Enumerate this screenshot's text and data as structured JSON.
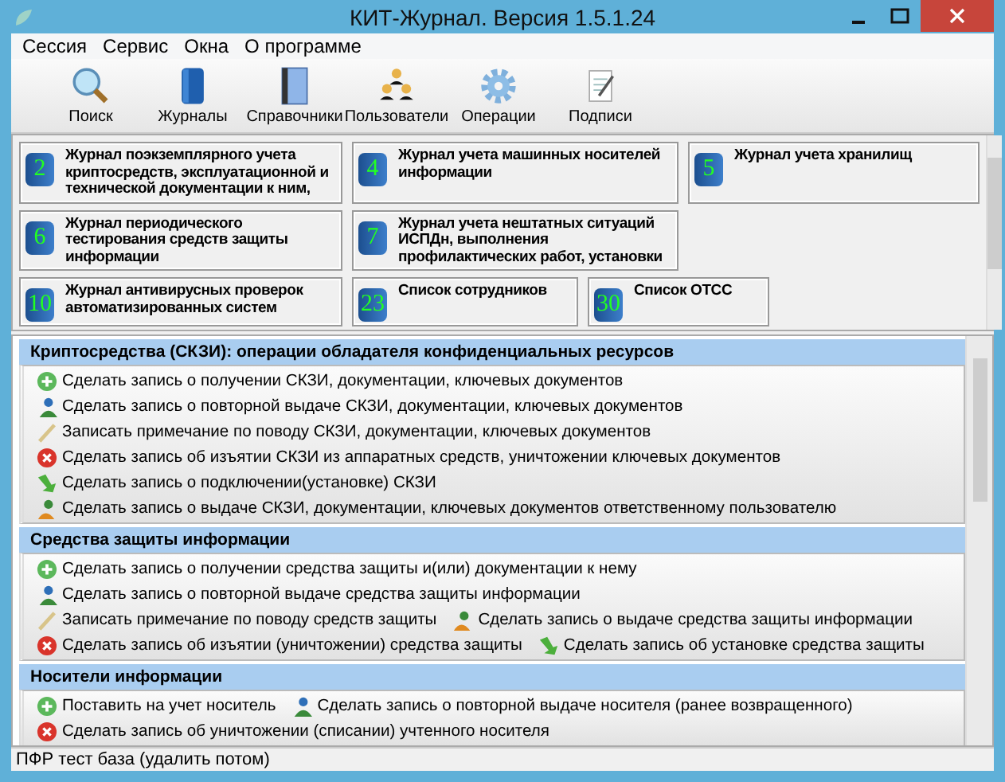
{
  "window": {
    "title": "КИТ-Журнал. Версия 1.5.1.24"
  },
  "menu": [
    "Сессия",
    "Сервис",
    "Окна",
    "О программе"
  ],
  "toolbar": [
    {
      "kind": "search",
      "label": "Поиск"
    },
    {
      "kind": "journal",
      "label": "Журналы"
    },
    {
      "kind": "reference",
      "label": "Справочники"
    },
    {
      "kind": "users",
      "label": "Пользователи"
    },
    {
      "kind": "operations",
      "label": "Операции"
    },
    {
      "kind": "signatures",
      "label": "Подписи"
    }
  ],
  "journal_rows": [
    [
      {
        "number": "2",
        "title": "Журнал поэкземплярного учета криптосредств, эксплуатационной и технической документации к ним,"
      },
      {
        "number": "4",
        "title": "Журнал учета машинных носителей информации"
      },
      {
        "number": "5",
        "title": "Журнал учета хранилищ"
      }
    ],
    [
      {
        "number": "6",
        "title": "Журнал периодического тестирования средств защиты информации"
      },
      {
        "number": "7",
        "title": "Журнал учета нештатных ситуаций ИСПДн, выполнения профилактических работ, установки"
      }
    ],
    [
      {
        "number": "10",
        "title": "Журнал антивирусных проверок автоматизированных систем"
      },
      {
        "number": "23",
        "title": "Список сотрудников"
      },
      {
        "number": "30",
        "title": "Список ОТСС"
      }
    ]
  ],
  "sections": [
    {
      "title": "Криптосредства (СКЗИ): операции обладателя конфиденциальных ресурсов",
      "rows": [
        [
          {
            "kind": "add",
            "label": "Сделать запись о получении СКЗИ, документации, ключевых документов"
          }
        ],
        [
          {
            "kind": "user",
            "label": "Сделать запись о повторной выдаче СКЗИ, документации, ключевых документов"
          }
        ],
        [
          {
            "kind": "note",
            "label": "Записать примечание по поводу СКЗИ, документации, ключевых документов"
          }
        ],
        [
          {
            "kind": "remove",
            "label": "Сделать запись об изъятии СКЗИ из аппаратных средств, уничтожении ключевых документов"
          }
        ],
        [
          {
            "kind": "install",
            "label": "Сделать запись о подключении(установке) СКЗИ"
          }
        ],
        [
          {
            "kind": "issue",
            "label": "Сделать запись о выдаче СКЗИ, документации, ключевых документов ответственному пользователю"
          }
        ]
      ]
    },
    {
      "title": "Средства защиты информации",
      "rows": [
        [
          {
            "kind": "add",
            "label": "Сделать запись о получении средства защиты и(или) документации к нему"
          }
        ],
        [
          {
            "kind": "user",
            "label": "Сделать запись о повторной выдаче средства защиты информации"
          }
        ],
        [
          {
            "kind": "note",
            "label": "Записать примечание по поводу средств защиты"
          },
          {
            "kind": "issue",
            "label": "Сделать запись о выдаче средства защиты информации"
          }
        ],
        [
          {
            "kind": "remove",
            "label": "Сделать запись об изъятии (уничтожении) средства защиты"
          },
          {
            "kind": "install",
            "label": "Сделать запись об установке средства защиты"
          }
        ]
      ]
    },
    {
      "title": "Носители информации",
      "rows": [
        [
          {
            "kind": "add",
            "label": "Поставить на учет носитель"
          },
          {
            "kind": "user",
            "label": "Сделать запись о повторной выдаче носителя (ранее возвращенного)"
          }
        ],
        [
          {
            "kind": "remove",
            "label": "Сделать запись об уничтожении (списании) учтенного носителя"
          }
        ]
      ]
    }
  ],
  "status_bar": "ПФР тест база (удалить потом)"
}
